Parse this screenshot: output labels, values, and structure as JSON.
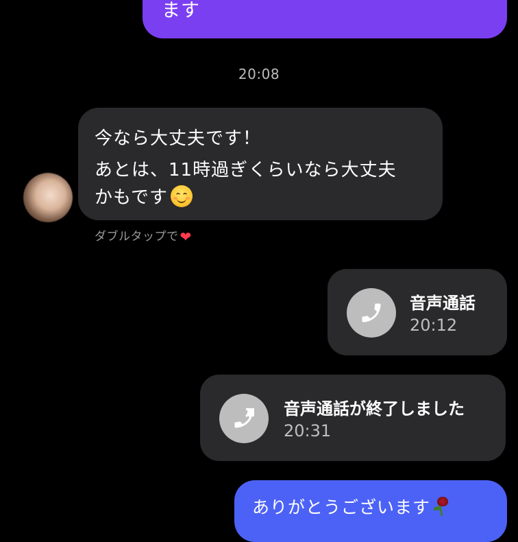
{
  "messages": {
    "outgoing_top_text": "ます",
    "timestamp": "20:08",
    "incoming_line1": "今なら大丈夫です！",
    "incoming_line2": "あとは、11時過ぎくらいなら大丈夫",
    "incoming_line3": "かもです",
    "double_tap_hint": "ダブルタップで",
    "outgoing_bottom_text": "ありがとうございます"
  },
  "calls": [
    {
      "title": "音声通話",
      "time": "20:12",
      "icon": "phone-icon"
    },
    {
      "title": "音声通話が終了しました",
      "time": "20:31",
      "icon": "phone-outgoing-icon"
    }
  ],
  "emojis": {
    "smile": "smiling-face-emoji",
    "heart": "❤",
    "rose": "wilted-rose-emoji"
  },
  "colors": {
    "background": "#000000",
    "outgoing_purple": "#7b3ff2",
    "outgoing_blue": "#4c62f6",
    "incoming_bubble": "#2a2a2c",
    "muted_text": "#9a9a9a"
  }
}
